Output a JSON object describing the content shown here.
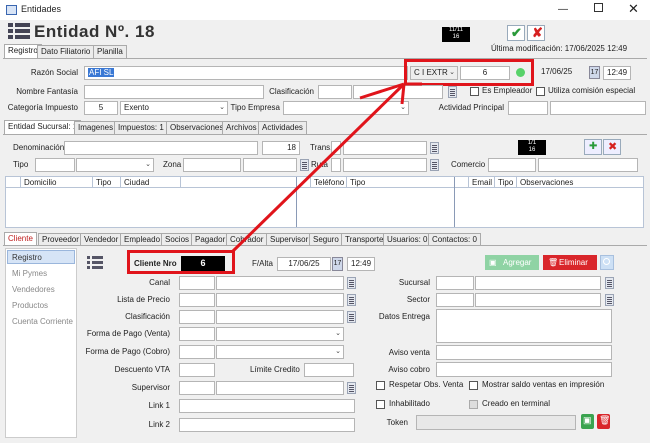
{
  "window": {
    "title": "Entidades"
  },
  "header": {
    "title": "Entidad Nº. 18",
    "badge_top": "11/11",
    "badge_bottom": "16",
    "last_modified": "Última modificación: 17/06/2025 12:49"
  },
  "main_tabs": [
    "Registro",
    "Dato Filiatorio",
    "Planilla"
  ],
  "form": {
    "razon_social_label": "Razón Social",
    "razon_social": "AFI SL",
    "cond_iva": "C I EXTR",
    "cond_num": "6",
    "fecha": "17/06/25",
    "fecha_day": "17",
    "hora": "12:49",
    "nombre_fantasia_label": "Nombre Fantasía",
    "clasificacion_label": "Clasificación",
    "es_empleador_label": "Es Empleador",
    "comision_label": "Utiliza comisión especial",
    "categoria_label": "Categoría Impuesto",
    "categoria_code": "5",
    "categoria_value": "Exento",
    "tipo_empresa_label": "Tipo Empresa",
    "actividad_label": "Actividad Principal"
  },
  "sub_tabs": [
    "Entidad Sucursal: 1",
    "Imagenes",
    "Impuestos: 1",
    "Observaciones",
    "Archivos",
    "Actividades"
  ],
  "sucursal": {
    "denominacion_label": "Denominación",
    "denominacion_num": "18",
    "trans_label": "Trans.",
    "badge_top": "1/1",
    "badge_bottom": "16",
    "tipo_label": "Tipo",
    "zona_label": "Zona",
    "ruta_label": "Ruta",
    "comercio_label": "Comercio"
  },
  "grid": {
    "columns_left": [
      "Domicilio",
      "Tipo",
      "Ciudad"
    ],
    "columns_mid": [
      "Teléfono",
      "Tipo"
    ],
    "columns_right": [
      "Email",
      "Tipo",
      "Observaciones"
    ]
  },
  "role_tabs": [
    "Cliente",
    "Proveedor",
    "Vendedor",
    "Empleado",
    "Socios",
    "Pagador",
    "Cobrador",
    "Supervisor",
    "Seguro",
    "Transporte",
    "Usuarios: 0",
    "Contactos: 0"
  ],
  "side_nav": [
    "Registro",
    "Mi Pymes",
    "Vendedores",
    "Productos",
    "Cuenta Corriente"
  ],
  "cliente": {
    "cliente_nro_label": "Cliente Nro",
    "cliente_nro": "6",
    "falta_label": "F/Alta",
    "falta_fecha": "17/06/25",
    "falta_day": "17",
    "falta_hora": "12:49",
    "agregar_label": "Agregar",
    "eliminar_label": "Eliminar",
    "canal_label": "Canal",
    "lista_precio_label": "Lista de Precio",
    "clasificacion_label": "Clasificación",
    "forma_venta_label": "Forma de Pago (Venta)",
    "forma_cobro_label": "Forma de Pago (Cobro)",
    "descuento_label": "Descuento VTA",
    "limite_label": "Límite Credito",
    "supervisor_label": "Supervisor",
    "link1_label": "Link 1",
    "link2_label": "Link 2",
    "sucursal_label": "Sucursal",
    "sector_label": "Sector",
    "datos_entrega_label": "Datos Entrega",
    "aviso_venta_label": "Aviso venta",
    "aviso_cobro_label": "Aviso cobro",
    "respetar_label": "Respetar Obs. Venta",
    "mostrar_saldo_label": "Mostrar saldo ventas en impresión",
    "inhabilitado_label": "Inhabilitado",
    "creado_terminal_label": "Creado en terminal",
    "token_label": "Token"
  },
  "colors": {
    "accent": "#e0141b",
    "badge_bg": "#000000",
    "agregar_bg": "#8fd3a4",
    "eliminar_bg": "#d9262b"
  }
}
